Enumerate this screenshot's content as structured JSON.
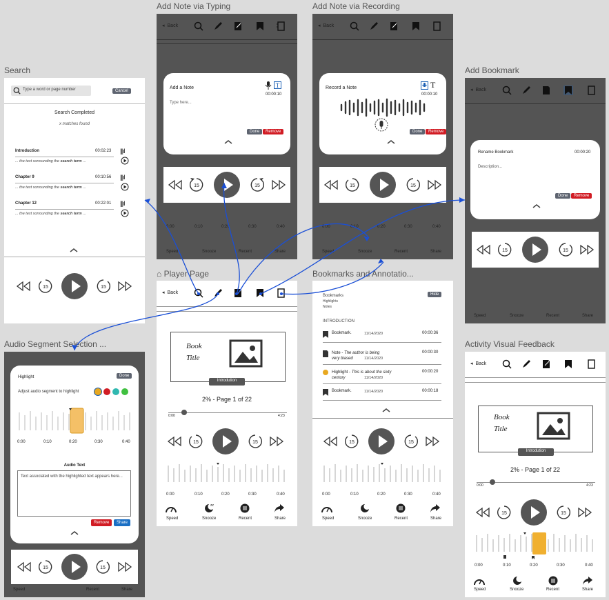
{
  "frames": {
    "typing": "Add Note via Typing",
    "recording": "Add Note via Recording",
    "search": "Search",
    "bookmark": "Add Bookmark",
    "player": "Player Page",
    "annotations": "Bookmarks and Annotatio...",
    "segment": "Audio Segment Selection ...",
    "feedback": "Activity Visual Feedback"
  },
  "common": {
    "back": "Back",
    "done": "Done",
    "remove": "Remove",
    "share": "Share",
    "speed": "Speed",
    "snooze": "Snooze",
    "recent": "Recent",
    "skip": "15",
    "t0": "0:00",
    "t10": "0:10",
    "t20": "0:20",
    "t30": "0:30",
    "t40": "0:40",
    "end": "4:23",
    "book_title_1": "Book",
    "book_title_2": "Title",
    "introdution": "Introdution",
    "progress": "2%  - Page 1 of 22"
  },
  "typing": {
    "title": "Add a Note",
    "placeholder": "Type here...",
    "time": "00:00:10"
  },
  "recording": {
    "title": "Record a Note",
    "time": "00:00:10"
  },
  "search": {
    "placeholder": "Type a word or page number",
    "cancel": "Cancel",
    "completed": "Search Completed",
    "matches": "x matches found",
    "snippet_pre": "... the text sorrounding the ",
    "snippet_term": "search term",
    "snippet_post": " ...",
    "results": [
      {
        "chapter": "Introduction",
        "time": "00:02:23"
      },
      {
        "chapter": "Chapter 9",
        "time": "00:10:56"
      },
      {
        "chapter": "Chapter 12",
        "time": "00:22:01"
      }
    ]
  },
  "bookmark": {
    "title": "Rename Bookmark",
    "time": "00:00:20",
    "desc": "Description..."
  },
  "annotations": {
    "tab1": "Bookmarks",
    "tab2": "Highlights",
    "tab3": "Notes",
    "hide": "Hide",
    "section": "INTRODUCTION",
    "items": [
      {
        "type": "Bookmark.",
        "date": "11/14/2020",
        "time": "00:00:36"
      },
      {
        "type": "Note",
        "text": "The author is being very biased",
        "date": "11/14/2020",
        "time": "00:00:30"
      },
      {
        "type": "Highlight",
        "text": "This is about the sixty century",
        "date": "11/14/2020",
        "time": "00:00:20"
      },
      {
        "type": "Bookmark.",
        "date": "11/14/2020",
        "time": "00:00:18"
      }
    ]
  },
  "segment": {
    "title": "Highlight",
    "adjust": "Adjust audio segment to highlight",
    "audio_text": "Audio Text",
    "body": "Text associated with the highlighted text appears here...",
    "colors": [
      "#e8a820",
      "#d11c24",
      "#30b8b0",
      "#40c040"
    ]
  }
}
